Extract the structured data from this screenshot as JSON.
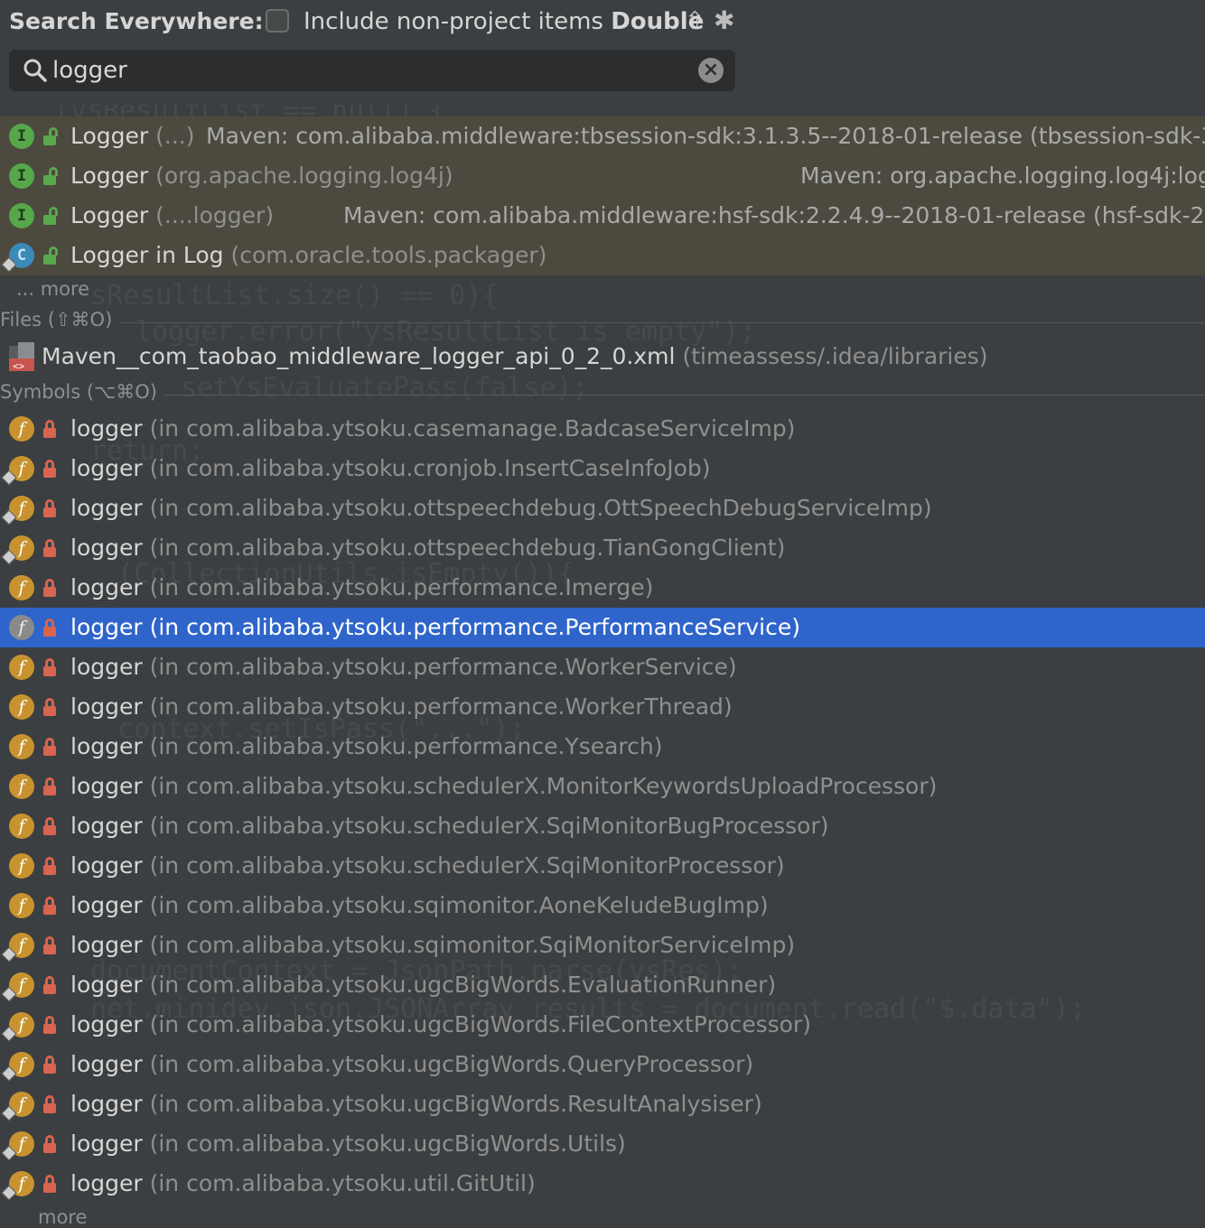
{
  "header": {
    "title": "Search Everywhere:",
    "include_label": "Include non-project items",
    "shortcut_label": "Double",
    "include_checked": false
  },
  "search": {
    "value": "logger",
    "placeholder": ""
  },
  "nonproject_results": [
    {
      "kind": "I",
      "name": "Logger",
      "context": "(...)",
      "location": "Maven: com.alibaba.middleware:tbsession-sdk:3.1.3.5--2018-01-release (tbsession-sdk-3"
    },
    {
      "kind": "I",
      "name": "Logger",
      "context": "(org.apache.logging.log4j)",
      "location": "Maven: org.apache.logging.log4j:log"
    },
    {
      "kind": "I",
      "name": "Logger",
      "context": "(....logger)",
      "location": "Maven: com.alibaba.middleware:hsf-sdk:2.2.4.9--2018-01-release (hsf-sdk-2"
    },
    {
      "kind": "C",
      "name": "Logger in Log",
      "context": "(com.oracle.tools.packager)",
      "location": ""
    }
  ],
  "more_label": "... more",
  "more_label_bottom": "more",
  "files_section": {
    "header": "Files (⇧⌘O)",
    "items": [
      {
        "name": "Maven__com_taobao_middleware_logger_api_0_2_0.xml",
        "context": "(timeassess/.idea/libraries)"
      }
    ]
  },
  "symbols_section": {
    "header": "Symbols (⌥⌘O)",
    "selected_index": 5,
    "items": [
      {
        "name": "logger",
        "context": "(in com.alibaba.ytsoku.casemanage.BadcaseServiceImp)"
      },
      {
        "name": "logger",
        "context": "(in com.alibaba.ytsoku.cronjob.InsertCaseInfoJob)"
      },
      {
        "name": "logger",
        "context": "(in com.alibaba.ytsoku.ottspeechdebug.OttSpeechDebugServiceImp)"
      },
      {
        "name": "logger",
        "context": "(in com.alibaba.ytsoku.ottspeechdebug.TianGongClient)"
      },
      {
        "name": "logger",
        "context": "(in com.alibaba.ytsoku.performance.Imerge)"
      },
      {
        "name": "logger",
        "context": "(in com.alibaba.ytsoku.performance.PerformanceService)"
      },
      {
        "name": "logger",
        "context": "(in com.alibaba.ytsoku.performance.WorkerService)"
      },
      {
        "name": "logger",
        "context": "(in com.alibaba.ytsoku.performance.WorkerThread)"
      },
      {
        "name": "logger",
        "context": "(in com.alibaba.ytsoku.performance.Ysearch)"
      },
      {
        "name": "logger",
        "context": "(in com.alibaba.ytsoku.schedulerX.MonitorKeywordsUploadProcessor)"
      },
      {
        "name": "logger",
        "context": "(in com.alibaba.ytsoku.schedulerX.SqiMonitorBugProcessor)"
      },
      {
        "name": "logger",
        "context": "(in com.alibaba.ytsoku.schedulerX.SqiMonitorProcessor)"
      },
      {
        "name": "logger",
        "context": "(in com.alibaba.ytsoku.sqimonitor.AoneKeludeBugImp)"
      },
      {
        "name": "logger",
        "context": "(in com.alibaba.ytsoku.sqimonitor.SqiMonitorServiceImp)"
      },
      {
        "name": "logger",
        "context": "(in com.alibaba.ytsoku.ugcBigWords.EvaluationRunner)"
      },
      {
        "name": "logger",
        "context": "(in com.alibaba.ytsoku.ugcBigWords.FileContextProcessor)"
      },
      {
        "name": "logger",
        "context": "(in com.alibaba.ytsoku.ugcBigWords.QueryProcessor)"
      },
      {
        "name": "logger",
        "context": "(in com.alibaba.ytsoku.ugcBigWords.ResultAnalysiser)"
      },
      {
        "name": "logger",
        "context": "(in com.alibaba.ytsoku.ugcBigWords.Utils)"
      },
      {
        "name": "logger",
        "context": "(in com.alibaba.ytsoku.util.GitUtil)"
      }
    ]
  },
  "colors": {
    "background": "#3c3f41",
    "nonproject_row": "#4c4a3e",
    "selection": "#2f65ca",
    "interface_icon": "#57a64a",
    "class_icon": "#3c8ab8",
    "field_icon": "#c8932f",
    "private_lock": "#d9644f",
    "public_lock": "#59a84c"
  },
  "icons": {
    "search": "search-icon",
    "clear": "clear-icon",
    "settings": "gear-icon",
    "shift": "shift-icon",
    "interface": "interface-icon",
    "class": "class-icon",
    "field": "field-icon",
    "private": "lock-icon",
    "public": "unlocked-icon",
    "xml_file": "xml-file-icon"
  }
}
